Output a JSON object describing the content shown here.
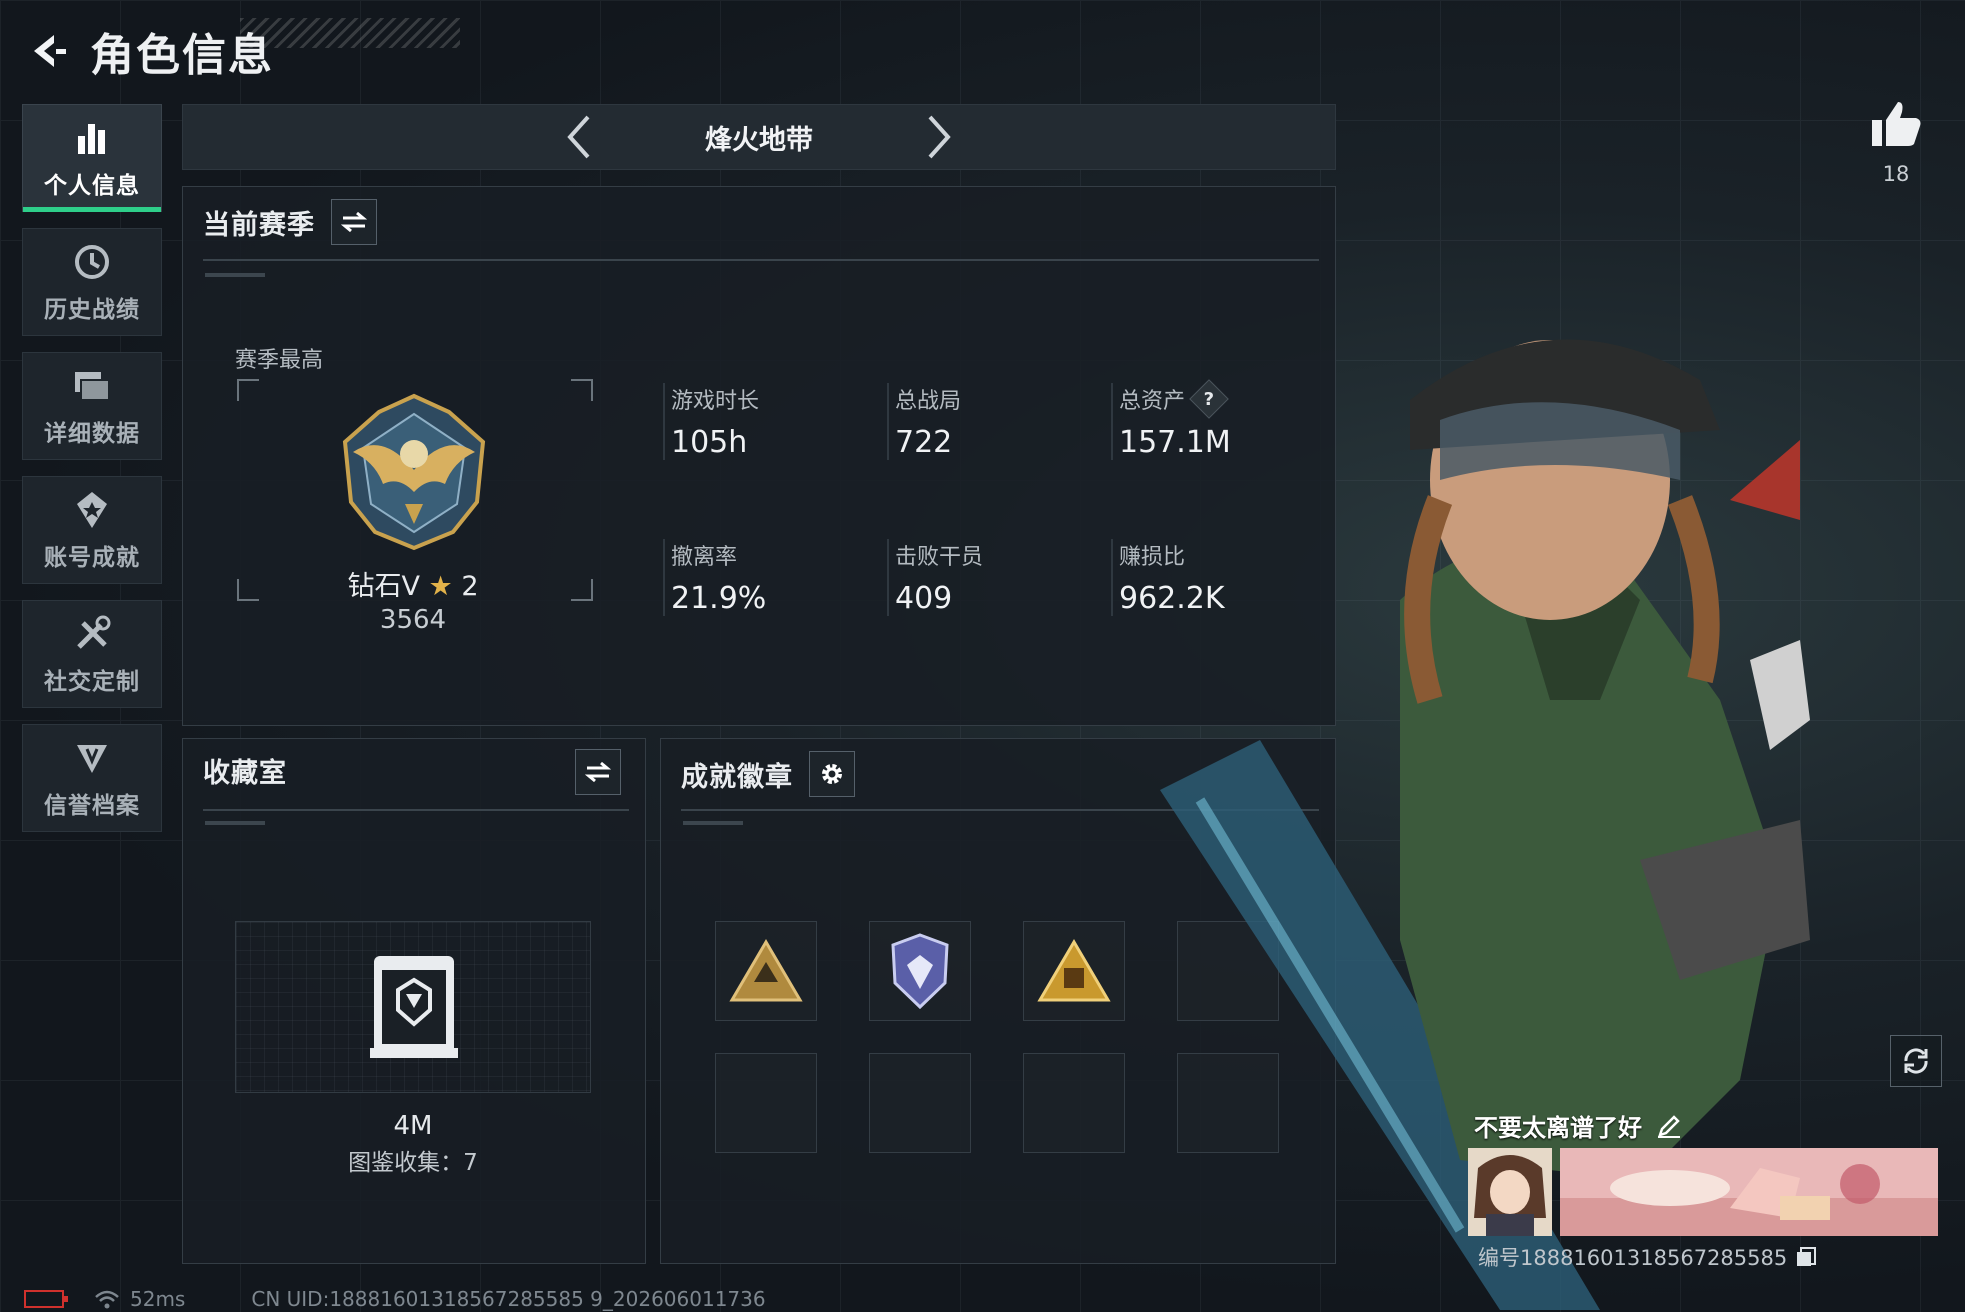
{
  "header": {
    "title": "角色信息"
  },
  "sidebar": {
    "items": [
      {
        "label": "个人信息",
        "icon": "bar-chart-icon",
        "active": true
      },
      {
        "label": "历史战绩",
        "icon": "history-clock-icon"
      },
      {
        "label": "详细数据",
        "icon": "folder-icon"
      },
      {
        "label": "账号成就",
        "icon": "achievement-icon"
      },
      {
        "label": "社交定制",
        "icon": "tools-icon"
      },
      {
        "label": "信誉档案",
        "icon": "reputation-icon"
      }
    ]
  },
  "mode": {
    "name": "烽火地带"
  },
  "season": {
    "title": "当前赛季",
    "best_label": "赛季最高",
    "rank_name": "钻石V",
    "rank_stars": "2",
    "rank_score": "3564",
    "stats": [
      {
        "label": "游戏时长",
        "value": "105h"
      },
      {
        "label": "总战局",
        "value": "722"
      },
      {
        "label": "总资产",
        "value": "157.1M",
        "has_help": true
      },
      {
        "label": "撤离率",
        "value": "21.9%"
      },
      {
        "label": "击败干员",
        "value": "409"
      },
      {
        "label": "赚损比",
        "value": "962.2K"
      }
    ],
    "help_glyph": "?"
  },
  "collection": {
    "title": "收藏室",
    "value": "4M",
    "count_text": "图鉴收集：7"
  },
  "badges": {
    "title": "成就徽章"
  },
  "profile": {
    "likes": "18",
    "signature": "不要太离谱了好",
    "id_text": "编号18881601318567285585"
  },
  "status": {
    "ping": "52ms",
    "uid": "CN UID:18881601318567285585 9_202606011736"
  },
  "colors": {
    "accent": "#2ecf8a",
    "gold": "#e2b24a",
    "battery": "#d0312d"
  }
}
